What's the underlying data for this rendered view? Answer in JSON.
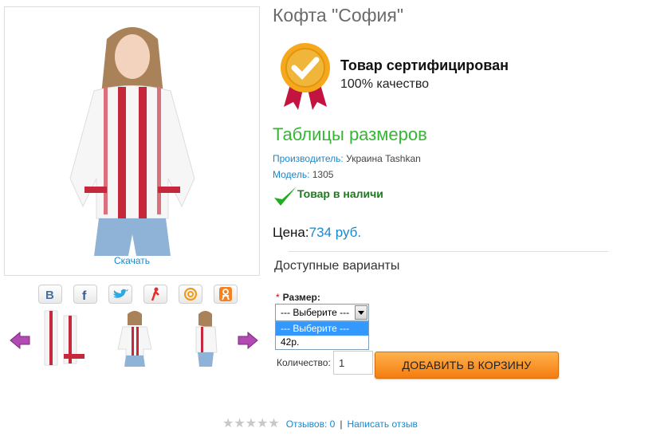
{
  "product": {
    "title": "Кофта \"София\"",
    "download_label": "Скачать"
  },
  "certificate": {
    "line1": "Товар сертифицирован",
    "line2": "100% качество"
  },
  "size_table_link": "Таблицы размеров",
  "manufacturer": {
    "label": "Производитель:",
    "value": "Украина Tashkan"
  },
  "model": {
    "label": "Модель:",
    "value": "1305"
  },
  "stock_status": "Товар в наличи",
  "price": {
    "label": "Цена:",
    "value": "734 руб."
  },
  "variants": {
    "heading": "Доступные варианты",
    "size_required_mark": "*",
    "size_label": "Размер:",
    "size_selected": "--- Выберите ---",
    "size_options": [
      "--- Выберите ---",
      "42р."
    ]
  },
  "quantity": {
    "label": "Количество:",
    "value": "1"
  },
  "add_to_cart_label": "ДОБАВИТЬ В КОРЗИНУ",
  "rating": {
    "stars_filled": 0,
    "stars_total": 5
  },
  "reviews": {
    "label": "Отзывов: 0",
    "separator": "|",
    "write_label": "Написать отзыв"
  },
  "social_icons": [
    "vk-icon",
    "facebook-icon",
    "twitter-icon",
    "my-world-icon",
    "mail-ru-icon",
    "odnoklassniki-icon"
  ],
  "colors": {
    "link_blue": "#1b87c9",
    "green": "#36b633",
    "orange_button": "#f47d10"
  }
}
